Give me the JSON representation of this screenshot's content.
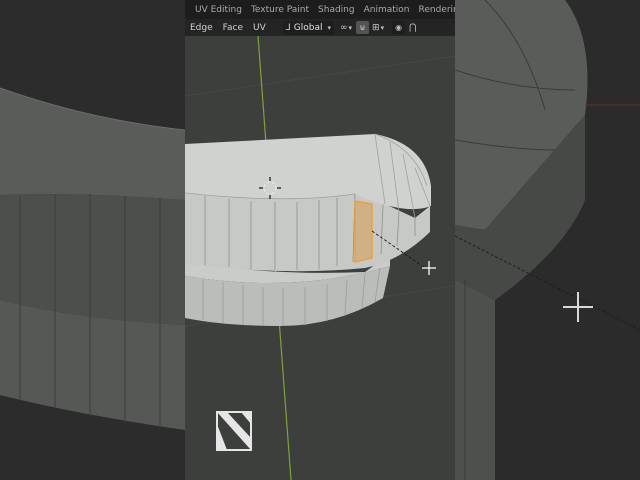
{
  "workspace_tabs": [
    {
      "label": "UV Editing"
    },
    {
      "label": "Texture Paint"
    },
    {
      "label": "Shading"
    },
    {
      "label": "Animation"
    },
    {
      "label": "Rendering"
    }
  ],
  "header": {
    "menus": [
      {
        "label": "Edge"
      },
      {
        "label": "Face"
      },
      {
        "label": "UV"
      }
    ],
    "transform_orientation": {
      "value": "Global"
    }
  },
  "icons": {
    "orientation": "transform-axes-icon",
    "pivot": "pivot-link-icon",
    "snap": "magnet-snap-icon",
    "snap_target": "snap-increment-icon",
    "proportional": "proportional-edit-icon",
    "falloff": "falloff-curve-icon",
    "cursor": "3d-cursor-icon",
    "move": "move-cursor-icon"
  },
  "colors": {
    "viewport_bg": "#3c3f3c",
    "mesh_light": "#cfd2cf",
    "mesh_mid": "#b5b8b5",
    "mesh_edge": "#5e615e",
    "selection": "#f0a030",
    "y_axis": "#7fa23a",
    "x_axis": "#a33a3a"
  }
}
